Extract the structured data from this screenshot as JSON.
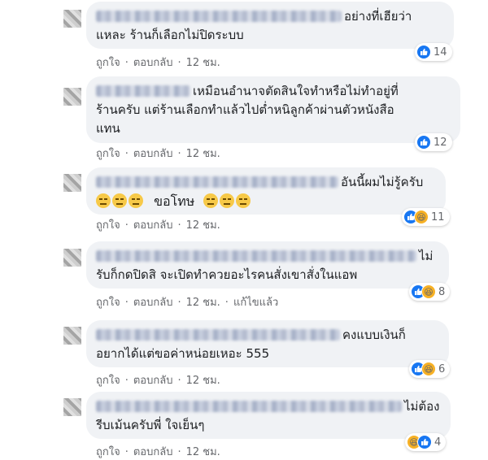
{
  "comments": [
    {
      "lines": [
        "อย่างที่เฮียว่า",
        "แหละ ร้านก็เลือกไม่ปิดระบบ"
      ],
      "actions": {
        "like": "ถูกใจ",
        "reply": "ตอบกลับ",
        "time": "12 ชม."
      },
      "reaction_count": "14",
      "reactions": [
        "like"
      ]
    },
    {
      "lines": [
        "เหมือนอำนาจตัดสินใจทำหรือไม่ทำอยู่ที่",
        "ร้านครับ แต่ร้านเลือกทำแล้วไปต่ำหนิลูกค้าผ่านตัวหนังสือ",
        "แทน"
      ],
      "actions": {
        "like": "ถูกใจ",
        "reply": "ตอบกลับ",
        "time": "12 ชม."
      },
      "reaction_count": "12",
      "reactions": [
        "like"
      ]
    },
    {
      "lines": [
        "อันนี้ผมไม่รู้ครับ",
        "ขอโทษ"
      ],
      "actions": {
        "like": "ถูกใจ",
        "reply": "ตอบกลับ",
        "time": "12 ชม."
      },
      "reaction_count": "11",
      "reactions": [
        "like",
        "haha"
      ]
    },
    {
      "lines": [
        "ไม่",
        "รับก็กดปิดสิ จะเปิดทำควยอะไรคนสั่งเขาสั่งในแอพ"
      ],
      "actions": {
        "like": "ถูกใจ",
        "reply": "ตอบกลับ",
        "time": "12 ชม.",
        "edited": "แก้ไขแล้ว"
      },
      "reaction_count": "8",
      "reactions": [
        "like",
        "haha"
      ]
    },
    {
      "lines": [
        "คงแบบเงินก็",
        "อยากได้แต่ขอค่าหน่อยเหอะ 555"
      ],
      "actions": {
        "like": "ถูกใจ",
        "reply": "ตอบกลับ",
        "time": "12 ชม."
      },
      "reaction_count": "6",
      "reactions": [
        "like",
        "haha"
      ]
    },
    {
      "lines": [
        "ไม่ต้อง",
        "รีบเม้นครับพี่ ใจเย็นๆ"
      ],
      "actions": {
        "like": "ถูกใจ",
        "reply": "ตอบกลับ",
        "time": "12 ชม."
      },
      "reaction_count": "4",
      "reactions": [
        "haha",
        "like"
      ]
    }
  ],
  "colors": {
    "bubble": "#f0f2f5",
    "meta": "#65676b",
    "like": "#1877f2",
    "haha": "#f7b125"
  },
  "icons": {
    "like": "thumbs-up-icon",
    "haha": "laughing-face-icon",
    "expressionless": "expressionless-face-icon"
  }
}
